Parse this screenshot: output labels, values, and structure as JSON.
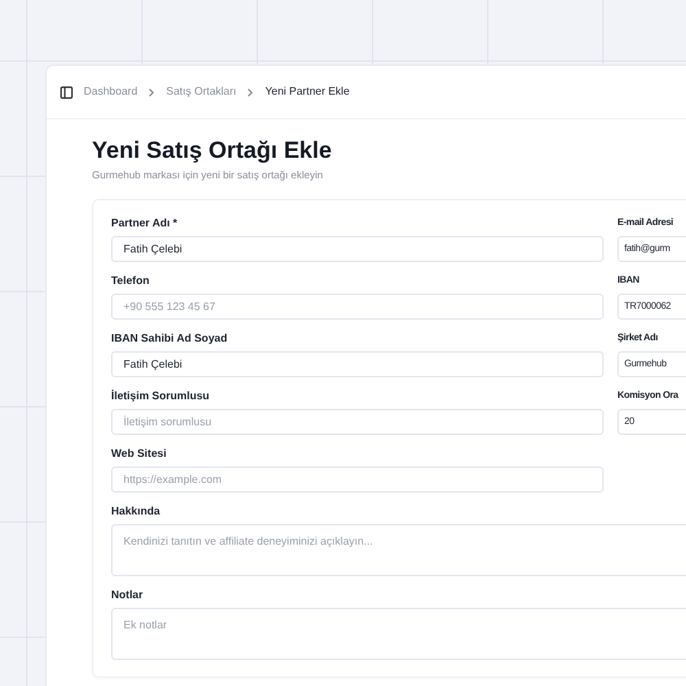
{
  "breadcrumb": [
    {
      "label": "Dashboard",
      "current": false
    },
    {
      "label": "Satış Ortakları",
      "current": false
    },
    {
      "label": "Yeni Partner Ekle",
      "current": true
    }
  ],
  "page": {
    "title": "Yeni Satış Ortağı Ekle",
    "subtitle": "Gurmehub markası için yeni bir satış ortağı ekleyin"
  },
  "rows": [
    {
      "left": {
        "label": "Partner Adı *",
        "value": "Fatih Çelebi"
      },
      "right": {
        "label": "E-mail Adresi",
        "value": "fatih@gurm"
      }
    },
    {
      "left": {
        "label": "Telefon",
        "placeholder": "+90 555 123 45 67"
      },
      "right": {
        "label": "IBAN",
        "value": "TR7000062"
      }
    },
    {
      "left": {
        "label": "IBAN Sahibi Ad Soyad",
        "value": "Fatih Çelebi"
      },
      "right": {
        "label": "Şirket Adı",
        "value": "Gurmehub"
      }
    },
    {
      "left": {
        "label": "İletişim Sorumlusu",
        "placeholder": "İletişim sorumlusu"
      },
      "right": {
        "label": "Komisyon Ora",
        "value": "20"
      }
    },
    {
      "left": {
        "label": "Web Sitesi",
        "placeholder": "https://example.com"
      }
    }
  ],
  "textareas": [
    {
      "label": "Hakkında",
      "placeholder": "Kendinizi tanıtın ve affiliate deneyiminizi açıklayın..."
    },
    {
      "label": "Notlar",
      "placeholder": "Ek notlar"
    }
  ]
}
